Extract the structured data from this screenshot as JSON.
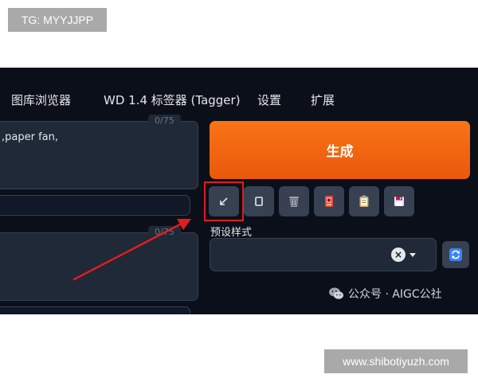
{
  "watermarks": {
    "top": "TG: MYYJJPP",
    "bottom": "www.shibotiyuzh.com"
  },
  "tabs": [
    {
      "label": "图库浏览器"
    },
    {
      "label": "WD 1.4 标签器 (Tagger)"
    },
    {
      "label": "设置"
    },
    {
      "label": "扩展"
    }
  ],
  "prompt": {
    "text": ",paper fan,",
    "counter": "0/75"
  },
  "negative_prompt": {
    "counter": "0/75"
  },
  "generate_label": "生成",
  "toolbar": {
    "buttons": [
      {
        "name": "read-params-button",
        "icon": "arrow-icon"
      },
      {
        "name": "clear-prompt-button",
        "icon": "square-icon"
      },
      {
        "name": "trash-button",
        "icon": "trash-icon"
      },
      {
        "name": "extra-networks-button",
        "icon": "card-icon"
      },
      {
        "name": "clipboard-button",
        "icon": "clipboard-icon"
      },
      {
        "name": "save-style-button",
        "icon": "floppy-icon"
      }
    ]
  },
  "styles": {
    "label": "预设样式",
    "clear_glyph": "×"
  },
  "footer_credit": "公众号 · AIGC公社",
  "colors": {
    "accent": "#f97316",
    "highlight": "#e11d1d",
    "panel_bg": "#0b0f19",
    "refresh": "#3b82f6"
  }
}
